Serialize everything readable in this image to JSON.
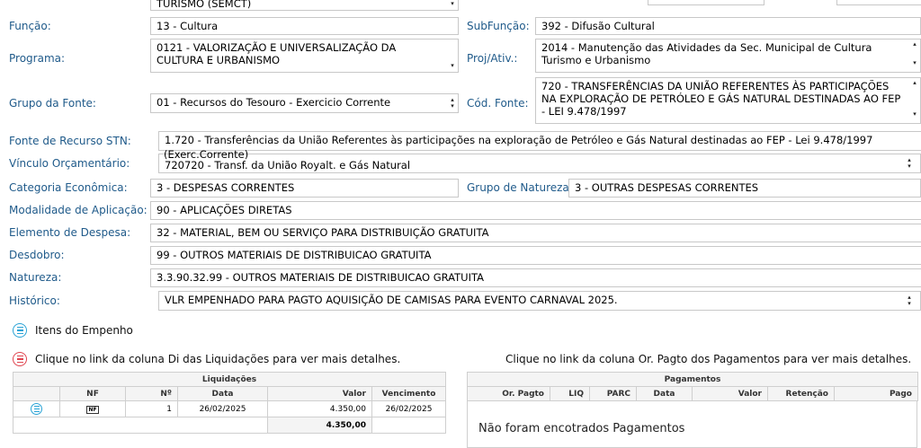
{
  "top": {
    "orgao_partial": "TURISMO (SEMCT)"
  },
  "fields": {
    "funcao": {
      "label": "Função:",
      "value": "13 - Cultura"
    },
    "subfuncao": {
      "label": "SubFunção:",
      "value": "392 - Difusão Cultural"
    },
    "programa": {
      "label": "Programa:",
      "value": "0121 - VALORIZAÇÃO E UNIVERSALIZAÇÃO DA CULTURA E URBANISMO"
    },
    "proj_ativ": {
      "label": "Proj/Ativ.:",
      "value": "2014 - Manutenção das Atividades da Sec. Municipal de Cultura Turismo e Urbanismo"
    },
    "grupo_fonte": {
      "label": "Grupo da Fonte:",
      "value": "01 - Recursos do Tesouro - Exercicio Corrente"
    },
    "cod_fonte": {
      "label": "Cód. Fonte:",
      "value": "720 - TRANSFERÊNCIAS DA UNIÃO REFERENTES ÀS PARTICIPAÇÕES NA EXPLORAÇÃO DE PETRÓLEO E GÁS NATURAL DESTINADAS AO FEP - LEI 9.478/1997"
    },
    "fonte_stn": {
      "label": "Fonte de Recurso STN:",
      "value": "1.720 - Transferências da União Referentes às participações na exploração de Petróleo e Gás Natural destinadas ao FEP - Lei 9.478/1997"
    },
    "fonte_stn_overflow": "(Exerc.Corrente)",
    "vinculo": {
      "label": "Vínculo Orçamentário:",
      "value": "720720 - Transf. da União Royalt. e Gás Natural"
    },
    "categoria": {
      "label": "Categoria Econômica:",
      "value": "3 - DESPESAS CORRENTES"
    },
    "grupo_natureza": {
      "label": "Grupo de Natureza:",
      "value": "3 - OUTRAS DESPESAS CORRENTES"
    },
    "modalidade": {
      "label": "Modalidade de Aplicação:",
      "value": "90 - APLICAÇÕES DIRETAS"
    },
    "elemento": {
      "label": "Elemento de Despesa:",
      "value": "32 - MATERIAL, BEM OU SERVIÇO PARA DISTRIBUIÇÃO GRATUITA"
    },
    "desdobro": {
      "label": "Desdobro:",
      "value": "99 - OUTROS MATERIAIS DE DISTRIBUICAO GRATUITA"
    },
    "natureza": {
      "label": "Natureza:",
      "value": "3.3.90.32.99 - OUTROS MATERIAIS DE DISTRIBUICAO GRATUITA"
    },
    "historico": {
      "label": "Histórico:",
      "value": "VLR EMPENHADO PARA PAGTO AQUISIÇÃO DE CAMISAS PARA EVENTO CARNAVAL 2025."
    }
  },
  "sections": {
    "itens": "Itens do Empenho",
    "liq_hint": "Clique no link da coluna Di das Liquidações para ver mais detalhes.",
    "pag_hint": "Clique no link da coluna Or. Pagto dos Pagamentos para ver mais detalhes."
  },
  "liquidacoes": {
    "title": "Liquidações",
    "columns": [
      "NF",
      "Nº",
      "Data",
      "Valor",
      "Vencimento"
    ],
    "rows": [
      {
        "nf": "NF",
        "num": "1",
        "data": "26/02/2025",
        "valor": "4.350,00",
        "vencimento": "26/02/2025"
      }
    ],
    "total": "4.350,00"
  },
  "pagamentos": {
    "title": "Pagamentos",
    "columns": [
      "Or. Pagto",
      "LIQ",
      "PARC",
      "Data",
      "Valor",
      "Retenção",
      "Pago"
    ],
    "empty": "Não foram encotrados Pagamentos"
  }
}
